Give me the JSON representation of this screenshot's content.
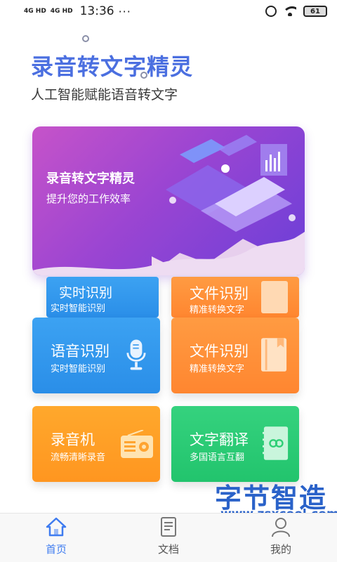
{
  "status_bar": {
    "signal1": "4G HD",
    "signal2": "4G HD",
    "time": "13:36",
    "dots": "···",
    "battery": "61"
  },
  "header": {
    "title": "录音转文字精灵",
    "subtitle": "人工智能赋能语音转文字"
  },
  "banner": {
    "title": "录音转文字精灵",
    "subtitle": "提升您的工作效率"
  },
  "cards": {
    "voice_ghost_title": "实时识别",
    "voice_ghost_sub": "实时智能识别",
    "file_ghost_title": "文件识别",
    "file_ghost_sub": "精准转换文字",
    "voice_title": "语音识别",
    "voice_sub": "实时智能识别",
    "file_title": "文件识别",
    "file_sub": "精准转换文字",
    "recorder_title": "录音机",
    "recorder_sub": "流畅清晰录音",
    "translate_title": "文字翻译",
    "translate_sub": "多国语言互翻"
  },
  "watermark": {
    "main": "字节智造",
    "url": "www.zsxcool.com"
  },
  "nav": {
    "home": "首页",
    "docs": "文档",
    "mine": "我的"
  },
  "colors": {
    "accent": "#3f7cf0",
    "title_blue": "#4b6fe0",
    "card_blue": "#2a8ee8",
    "card_orange": "#ff8630",
    "card_green": "#22c46d"
  }
}
